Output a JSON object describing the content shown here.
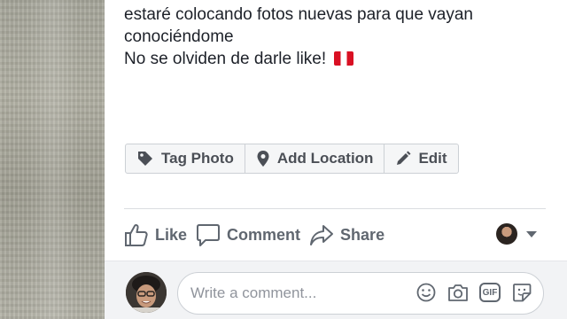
{
  "post": {
    "caption_lines": [
      "estaré colocando fotos nuevas para que vayan",
      "conociéndome",
      "No se olviden de darle like!"
    ],
    "flag_icon": "peru-flag-emoji"
  },
  "photo_toolbar": {
    "tag_photo": "Tag Photo",
    "add_location": "Add Location",
    "edit": "Edit"
  },
  "actions": {
    "like": "Like",
    "comment": "Comment",
    "share": "Share"
  },
  "comment": {
    "placeholder": "Write a comment...",
    "tools": [
      "smiley-icon",
      "camera-icon",
      "gif-icon",
      "sticker-icon"
    ]
  },
  "colors": {
    "text": "#1d2129",
    "secondary": "#606770",
    "border": "#ccd0d5",
    "comment_bg": "#f2f3f5",
    "flag_red": "#d91023"
  }
}
